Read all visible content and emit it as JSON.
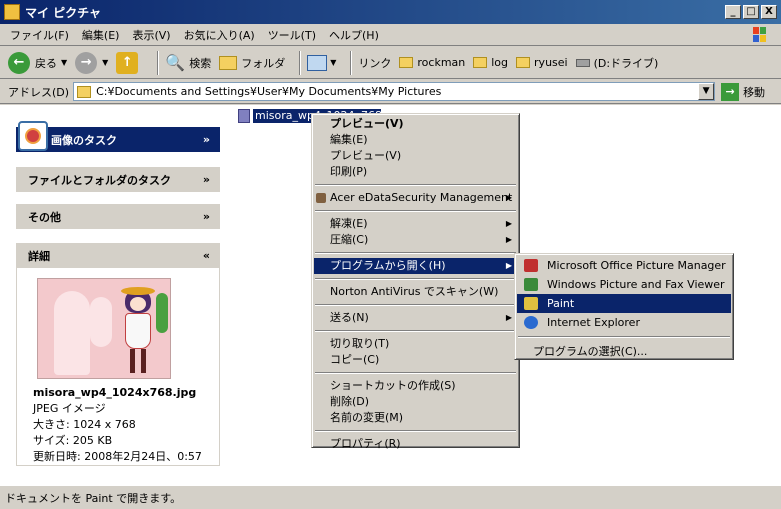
{
  "window": {
    "title": "マイ ピクチャ",
    "minimize": "_",
    "maximize": "□",
    "close": "X"
  },
  "menu": [
    "ファイル(F)",
    "編集(E)",
    "表示(V)",
    "お気に入り(A)",
    "ツール(T)",
    "ヘルプ(H)"
  ],
  "toolbar": {
    "back": "戻る",
    "search": "検索",
    "folders": "フォルダ",
    "links_label": "リンク",
    "links": [
      "rockman",
      "log",
      "ryusei",
      "(D:ドライブ)"
    ]
  },
  "address": {
    "label": "アドレス(D)",
    "value": "C:¥Documents and Settings¥User¥My Documents¥My Pictures",
    "go": "移動"
  },
  "taskpane": {
    "image_tasks": "画像のタスク",
    "file_folder_tasks": "ファイルとフォルダのタスク",
    "other": "その他",
    "details": "詳細",
    "details_body": {
      "filename": "misora_wp4_1024x768.jpg",
      "type": "JPEG イメージ",
      "dimensions": "大きさ: 1024 x 768",
      "size": "サイズ: 205 KB",
      "modified": "更新日時: 2008年2月24日、0:57"
    }
  },
  "selected_file": {
    "name": "misora_wp4_1024x768.jpg"
  },
  "context_menu": {
    "preview_bold": "プレビュー(V)",
    "edit": "編集(E)",
    "preview": "プレビュー(V)",
    "print": "印刷(P)",
    "acer": "Acer eDataSecurity Management",
    "extract": "解凍(E)",
    "compress": "圧縮(C)",
    "open_with": "プログラムから開く(H)",
    "norton": "Norton AntiVirus でスキャン(W)",
    "send_to": "送る(N)",
    "cut": "切り取り(T)",
    "copy": "コピー(C)",
    "create_shortcut": "ショートカットの作成(S)",
    "delete": "削除(D)",
    "rename": "名前の変更(M)",
    "properties": "プロパティ(R)"
  },
  "submenu": {
    "mopm": "Microsoft Office Picture Manager",
    "wpfv": "Windows Picture and Fax Viewer",
    "paint": "Paint",
    "ie": "Internet Explorer",
    "choose": "プログラムの選択(C)..."
  },
  "status": {
    "text": "ドキュメントを Paint で開きます。"
  },
  "colors": {
    "title_start": "#0a246a",
    "title_end": "#3a6ea5",
    "highlight": "#0a246a",
    "face": "#d4d0c8"
  }
}
